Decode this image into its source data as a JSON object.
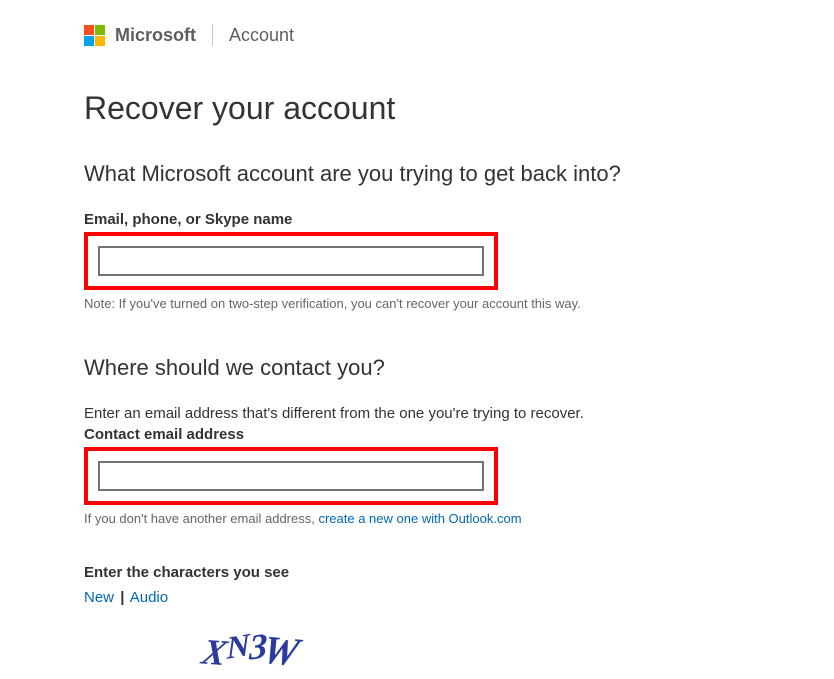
{
  "header": {
    "brand": "Microsoft",
    "section": "Account"
  },
  "page": {
    "title": "Recover your account"
  },
  "section1": {
    "heading": "What Microsoft account are you trying to get back into?",
    "field_label": "Email, phone, or Skype name",
    "input_value": "",
    "note": "Note: If you've turned on two-step verification, you can't recover your account this way."
  },
  "section2": {
    "heading": "Where should we contact you?",
    "instruction": "Enter an email address that's different from the one you're trying to recover.",
    "field_label": "Contact email address",
    "input_value": "",
    "hint_prefix": "If you don't have another email address, ",
    "hint_link": "create a new one with Outlook.com"
  },
  "captcha": {
    "label": "Enter the characters you see",
    "new_link": "New",
    "separator": "|",
    "audio_link": "Audio",
    "text": "XN3W"
  }
}
